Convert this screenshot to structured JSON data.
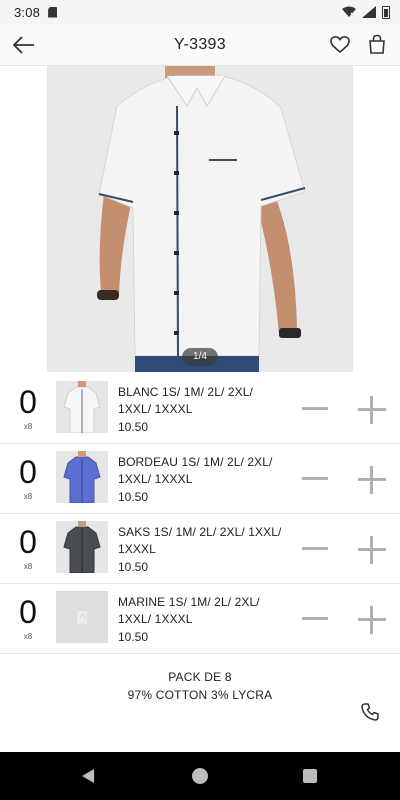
{
  "status_bar": {
    "time": "3:08",
    "icons": [
      "sd-card-icon",
      "wifi-off-icon",
      "signal-icon",
      "battery-icon"
    ]
  },
  "app_bar": {
    "title": "Y-3393",
    "icons": [
      "back-arrow-icon",
      "heart-icon",
      "shopping-bag-icon"
    ]
  },
  "gallery": {
    "pager": "1/4"
  },
  "variants": [
    {
      "qty": "0",
      "multiplier": "x8",
      "name": "BLANC 1S/ 1M/ 2L/ 2XL/ 1XXL/ 1XXXL",
      "price": "10.50",
      "shirt_color": "#eeeeef"
    },
    {
      "qty": "0",
      "multiplier": "x8",
      "name": "BORDEAU 1S/ 1M/ 2L/ 2XL/ 1XXL/ 1XXXL",
      "price": "10.50",
      "shirt_color": "#5a6fd0"
    },
    {
      "qty": "0",
      "multiplier": "x8",
      "name": "SAKS 1S/ 1M/ 2L/ 2XL/ 1XXL/ 1XXXL",
      "price": "10.50",
      "shirt_color": "#4a4d52"
    },
    {
      "qty": "0",
      "multiplier": "x8",
      "name": "MARINE 1S/ 1M/ 2L/ 2XL/ 1XXL/ 1XXXL",
      "price": "10.50",
      "shirt_color": null
    }
  ],
  "info": {
    "line1": "PACK DE 8",
    "line2": "97% COTTON 3% LYCRA"
  },
  "colors": {
    "stepper": "#b0b0b0",
    "divider": "#e8e8e8"
  }
}
